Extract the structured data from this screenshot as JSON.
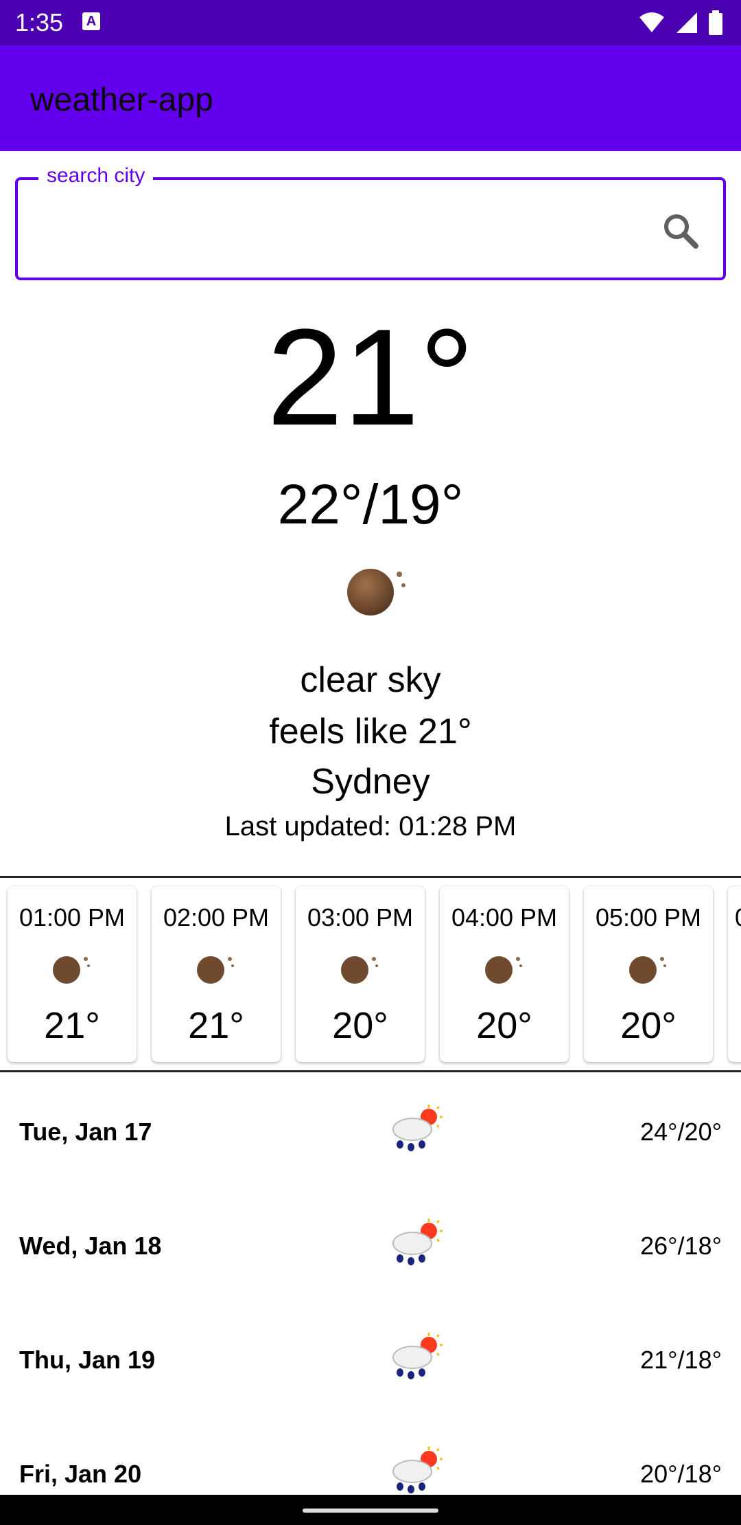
{
  "status_bar": {
    "time": "1:35",
    "notification_icon": "a-box-icon"
  },
  "app_bar": {
    "title": "weather-app"
  },
  "search": {
    "label": "search city",
    "value": "",
    "placeholder": ""
  },
  "current": {
    "temperature": "21°",
    "high_low": "22°/19°",
    "description": "clear sky",
    "feels_like": "feels like 21°",
    "city": "Sydney",
    "last_updated": "Last updated: 01:28 PM",
    "icon": "moon-clear-icon"
  },
  "hourly": [
    {
      "time": "01:00 PM",
      "temp": "21°",
      "icon": "moon-clear-icon"
    },
    {
      "time": "02:00 PM",
      "temp": "21°",
      "icon": "moon-clear-icon"
    },
    {
      "time": "03:00 PM",
      "temp": "20°",
      "icon": "moon-clear-icon"
    },
    {
      "time": "04:00 PM",
      "temp": "20°",
      "icon": "moon-clear-icon"
    },
    {
      "time": "05:00 PM",
      "temp": "20°",
      "icon": "moon-clear-icon"
    },
    {
      "time": "0",
      "temp": "",
      "icon": ""
    }
  ],
  "daily": [
    {
      "day": "Tue, Jan 17",
      "range": "24°/20°",
      "icon": "sun-rain-cloud-icon"
    },
    {
      "day": "Wed, Jan 18",
      "range": "26°/18°",
      "icon": "sun-rain-cloud-icon"
    },
    {
      "day": "Thu, Jan 19",
      "range": "21°/18°",
      "icon": "sun-rain-cloud-icon"
    },
    {
      "day": "Fri, Jan 20",
      "range": "20°/18°",
      "icon": "sun-rain-cloud-icon"
    }
  ],
  "colors": {
    "status_bar": "#4a00b0",
    "app_bar": "#6200ee",
    "accent": "#6200ee"
  }
}
